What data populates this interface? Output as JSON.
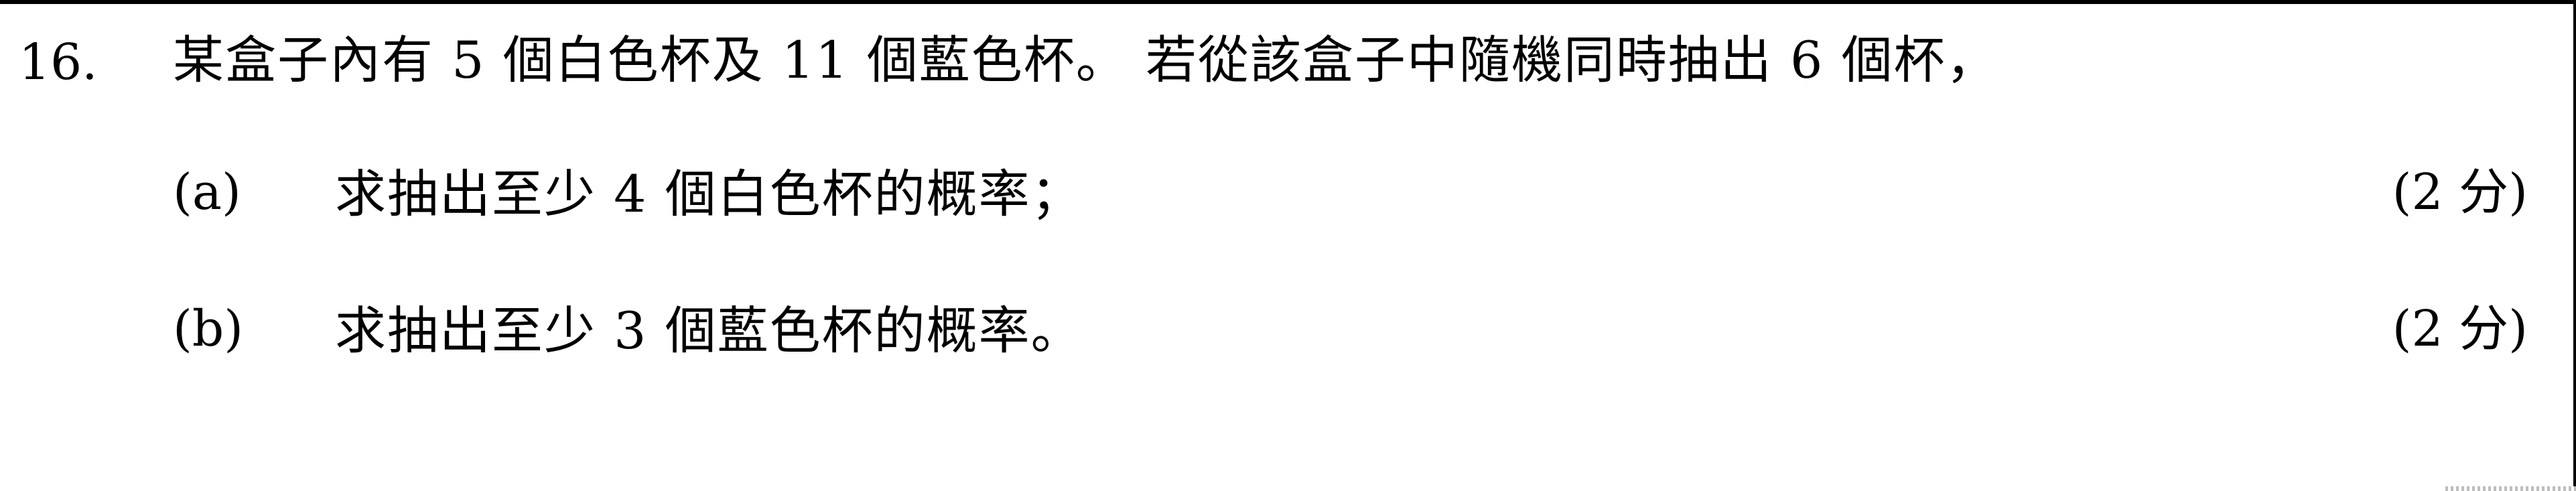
{
  "question": {
    "number": "16.",
    "stem": "某盒子內有 5 個白色杯及 11 個藍色杯。 若從該盒子中隨機同時抽出 6 個杯，",
    "parts": [
      {
        "label": "(a)",
        "text": "求抽出至少 4 個白色杯的概率；",
        "marks": "(2 分)"
      },
      {
        "label": "(b)",
        "text": "求抽出至少 3 個藍色杯的概率。",
        "marks": "(2 分)"
      }
    ]
  }
}
